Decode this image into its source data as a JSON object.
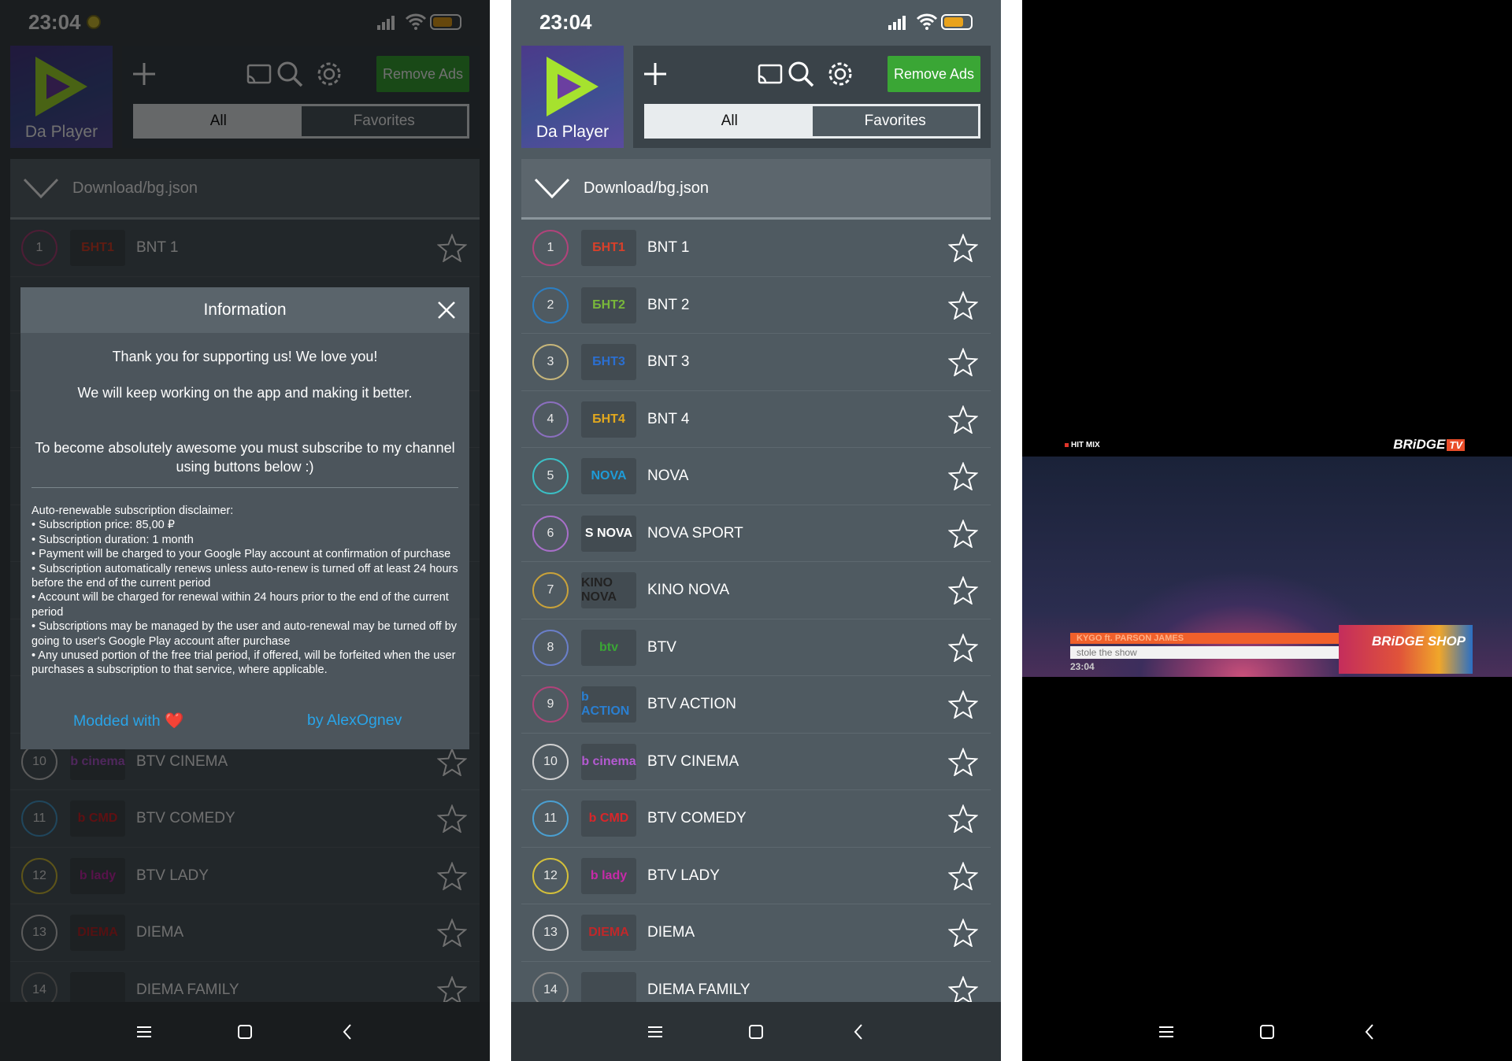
{
  "status_bar": {
    "time": "23:04"
  },
  "app": {
    "logo_text": "Da Player",
    "remove_ads": "Remove Ads",
    "tabs": [
      "All",
      "Favorites"
    ],
    "playlist": "Download/bg.json"
  },
  "channels": [
    {
      "num": "1",
      "name": "BNT 1",
      "logo_text": "БНТ1",
      "ring": "#b0437a",
      "logo_color": "#d9402a"
    },
    {
      "num": "2",
      "name": "BNT 2",
      "logo_text": "БНТ2",
      "ring": "#2c7fc4",
      "logo_color": "#79b83a"
    },
    {
      "num": "3",
      "name": "BNT 3",
      "logo_text": "БНТ3",
      "ring": "#c7b67a",
      "logo_color": "#2b6fd1"
    },
    {
      "num": "4",
      "name": "BNT 4",
      "logo_text": "БНТ4",
      "ring": "#8b6fbf",
      "logo_color": "#e2a81e"
    },
    {
      "num": "5",
      "name": "NOVA",
      "logo_text": "NOVA",
      "ring": "#3bbfc5",
      "logo_color": "#1e9bd7"
    },
    {
      "num": "6",
      "name": "NOVA SPORT",
      "logo_text": "S NOVA",
      "ring": "#a86fc9",
      "logo_color": "#ffffff"
    },
    {
      "num": "7",
      "name": "KINO NOVA",
      "logo_text": "KINO NOVA",
      "ring": "#c9a23a",
      "logo_color": "#222222"
    },
    {
      "num": "8",
      "name": "BTV",
      "logo_text": "btv",
      "ring": "#6a7fc9",
      "logo_color": "#3aa635"
    },
    {
      "num": "9",
      "name": "BTV ACTION",
      "logo_text": "b ACTION",
      "ring": "#b0437a",
      "logo_color": "#2a7fd1"
    },
    {
      "num": "10",
      "name": "BTV CINEMA",
      "logo_text": "b cinema",
      "ring": "#d0d0d0",
      "logo_color": "#b45ad1"
    },
    {
      "num": "11",
      "name": "BTV COMEDY",
      "logo_text": "b CMD",
      "ring": "#4a9fd1",
      "logo_color": "#d9262a"
    },
    {
      "num": "12",
      "name": "BTV LADY",
      "logo_text": "b lady",
      "ring": "#d4c03a",
      "logo_color": "#c72aa8"
    },
    {
      "num": "13",
      "name": "DIEMA",
      "logo_text": "DIEMA",
      "ring": "#d0d0d0",
      "logo_color": "#c0282a"
    },
    {
      "num": "14",
      "name": "DIEMA FAMILY",
      "logo_text": "",
      "ring": "#888888",
      "logo_color": "#c0282a"
    }
  ],
  "dialog": {
    "title": "Information",
    "line1": "Thank you for supporting us! We love you!",
    "line2": "We will keep working on the app and making it better.",
    "line3": "To become absolutely awesome you must subscribe to my channel using buttons below :)",
    "disclaimer_title": "Auto-renewable subscription disclaimer:",
    "disclaimer": [
      "• Subscription price: 85,00 ₽",
      "• Subscription duration: 1 month",
      "• Payment will be charged to your Google Play account at confirmation of purchase",
      "• Subscription automatically renews unless auto-renew is turned off at least 24 hours before the end of the current period",
      "• Account will be charged for renewal within 24 hours prior to the end of the current period",
      "• Subscriptions may be managed by the user and auto-renewal may be turned off by going to user's Google Play account after purchase",
      "• Any unused portion of the free trial period, if offered, will be forfeited when the user purchases a subscription to that service, where applicable."
    ],
    "modded": "Modded with ❤️",
    "author": "by AlexOgnev"
  },
  "video": {
    "hit_mix": "HIT MIX",
    "channel_logo": "BRiDGE",
    "channel_logo_tv": "TV",
    "ticker_artist": "KYGO ft. PARSON JAMES",
    "ticker_song": "stole the show",
    "time": "23:04",
    "shop": "BRiDGE SHOP"
  },
  "colors": {
    "accent_green": "#3aa635",
    "link_blue": "#29a4e8",
    "battery": "#e8a21c"
  }
}
